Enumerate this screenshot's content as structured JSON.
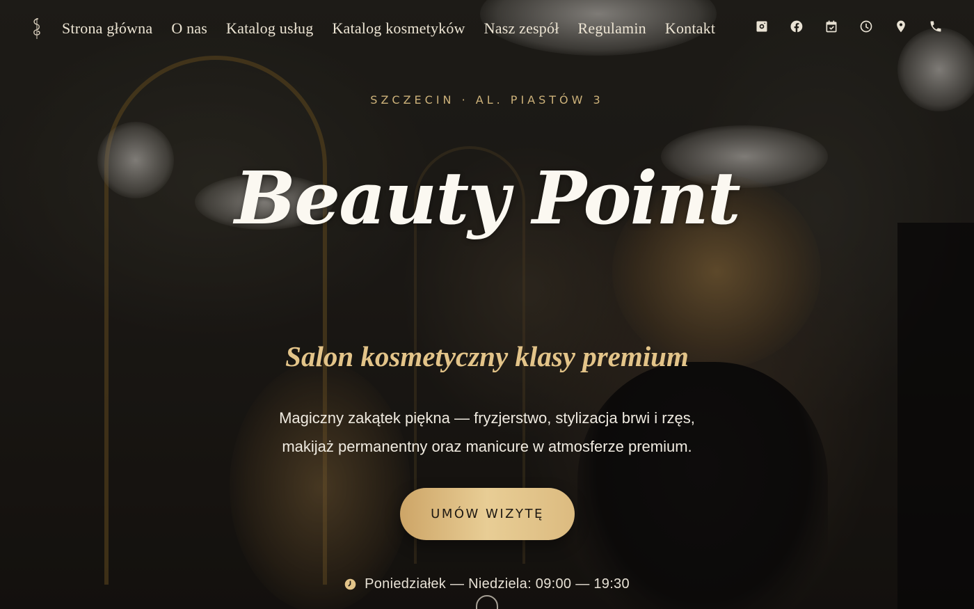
{
  "nav": {
    "items": [
      {
        "label": "Strona główna"
      },
      {
        "label": "O nas"
      },
      {
        "label": "Katalog usług"
      },
      {
        "label": "Katalog kosmetyków"
      },
      {
        "label": "Nasz zespół"
      },
      {
        "label": "Regulamin"
      },
      {
        "label": "Kontakt"
      }
    ],
    "icons": [
      "instagram-icon",
      "facebook-icon",
      "calendar-check-icon",
      "clock-icon",
      "map-pin-icon",
      "phone-icon"
    ]
  },
  "hero": {
    "location": "SZCZECIN · AL. PIASTÓW 3",
    "brand": "Beauty Point",
    "tagline": "Salon kosmetyczny klasy premium",
    "description_line1": "Magiczny zakątek piękna — fryzjerstwo, stylizacja brwi i rzęs,",
    "description_line2": "makijaż permanentny oraz manicure w atmosferze premium.",
    "cta_label": "UMÓW WIZYTĘ",
    "hours": "Poniedziałek — Niedziela: 09:00 — 19:30"
  },
  "colors": {
    "accent_gold": "#e3c489",
    "button_gold": "#dcbb80",
    "text_light": "#ece4d3",
    "background_dark": "#161310"
  }
}
